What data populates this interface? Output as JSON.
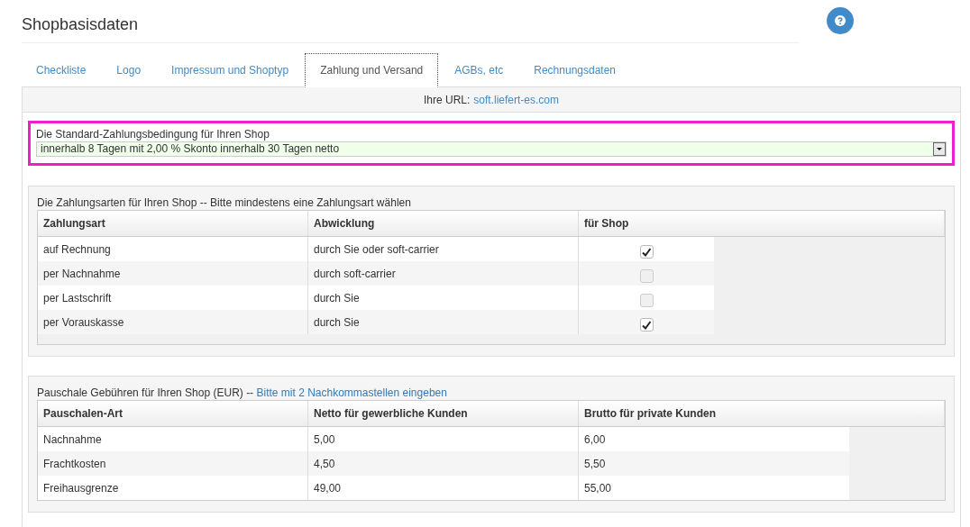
{
  "page_title": "Shopbasisdaten",
  "tabs": [
    {
      "label": "Checkliste",
      "selected": false
    },
    {
      "label": "Logo",
      "selected": false
    },
    {
      "label": "Impressum und Shoptyp",
      "selected": false
    },
    {
      "label": "Zahlung und Versand",
      "selected": true
    },
    {
      "label": "AGBs, etc",
      "selected": false
    },
    {
      "label": "Rechnungsdaten",
      "selected": false
    }
  ],
  "url_bar": {
    "label": "Ihre URL:",
    "link": "soft.liefert-es.com"
  },
  "payment_condition": {
    "label": "Die Standard-Zahlungsbedingung für Ihren Shop",
    "value": "innerhalb 8 Tagen mit 2,00 % Skonto innerhalb 30 Tagen netto"
  },
  "payment_methods": {
    "caption": "Die Zahlungsarten für Ihren Shop -- Bitte mindestens eine Zahlungsart wählen",
    "columns": [
      "Zahlungsart",
      "Abwicklung",
      "für Shop"
    ],
    "rows": [
      {
        "method": "auf Rechnung",
        "handling": "durch Sie oder soft-carrier",
        "checked": true
      },
      {
        "method": "per Nachnahme",
        "handling": "durch soft-carrier",
        "checked": false
      },
      {
        "method": "per Lastschrift",
        "handling": "durch Sie",
        "checked": false
      },
      {
        "method": "per Vorauskasse",
        "handling": "durch Sie",
        "checked": true
      }
    ]
  },
  "fees": {
    "caption": "Pauschale Gebühren für Ihren Shop (EUR) --",
    "caption_link": "Bitte mit 2 Nachkommastellen eingeben",
    "columns": [
      "Pauschalen-Art",
      "Netto für gewerbliche Kunden",
      "Brutto für private Kunden"
    ],
    "rows": [
      {
        "type": "Nachnahme",
        "net": "5,00",
        "gross": "6,00"
      },
      {
        "type": "Frachtkosten",
        "net": "4,50",
        "gross": "5,50"
      },
      {
        "type": "Freihausgrenze",
        "net": "49,00",
        "gross": "55,00"
      }
    ]
  }
}
